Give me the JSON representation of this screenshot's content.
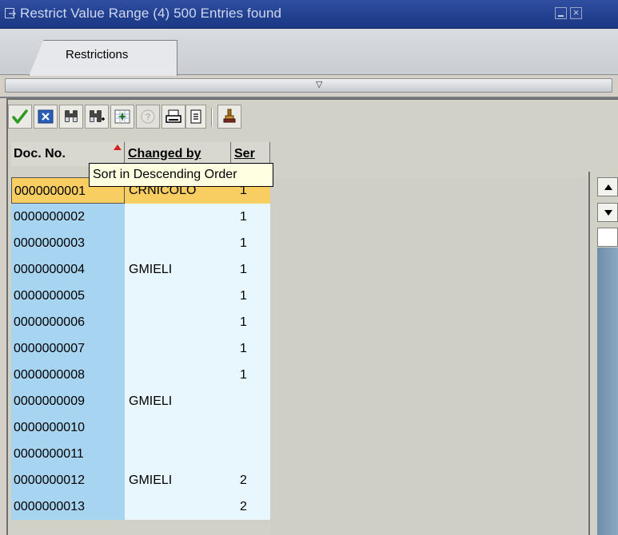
{
  "window": {
    "title": "Restrict Value Range (4)  500 Entries found",
    "minimize_icon": "minimize-icon",
    "close_icon": "close-icon"
  },
  "tabs": [
    {
      "label": "Restrictions",
      "active": true
    }
  ],
  "toolbar": {
    "buttons": [
      {
        "name": "confirm-button",
        "icon": "checkmark-icon"
      },
      {
        "name": "cancel-button",
        "icon": "x-icon"
      },
      {
        "name": "find-button",
        "icon": "binoculars-icon"
      },
      {
        "name": "find-next-button",
        "icon": "binoculars-plus-icon"
      },
      {
        "name": "new-search-button",
        "icon": "sparkle-grid-icon"
      },
      {
        "name": "help-button",
        "icon": "help-icon",
        "disabled": true
      },
      {
        "name": "print-button",
        "icon": "printer-icon"
      },
      {
        "name": "list-button",
        "icon": "list-icon"
      },
      {
        "name": "personal-list-button",
        "icon": "stamp-icon"
      }
    ]
  },
  "table": {
    "columns": [
      "Doc. No.",
      "Changed by",
      "Ser"
    ],
    "sorted_column": "Doc. No.",
    "rows": [
      {
        "doc": "0000000001",
        "changed_by": "CRNICOLO",
        "ser": "1",
        "selected": true
      },
      {
        "doc": "0000000002",
        "changed_by": "",
        "ser": "1"
      },
      {
        "doc": "0000000003",
        "changed_by": "",
        "ser": "1"
      },
      {
        "doc": "0000000004",
        "changed_by": "GMIELI",
        "ser": "1"
      },
      {
        "doc": "0000000005",
        "changed_by": "",
        "ser": "1"
      },
      {
        "doc": "0000000006",
        "changed_by": "",
        "ser": "1"
      },
      {
        "doc": "0000000007",
        "changed_by": "",
        "ser": "1"
      },
      {
        "doc": "0000000008",
        "changed_by": "",
        "ser": "1"
      },
      {
        "doc": "0000000009",
        "changed_by": "GMIELI",
        "ser": ""
      },
      {
        "doc": "0000000010",
        "changed_by": "",
        "ser": ""
      },
      {
        "doc": "0000000011",
        "changed_by": "",
        "ser": ""
      },
      {
        "doc": "0000000012",
        "changed_by": "GMIELI",
        "ser": "2"
      },
      {
        "doc": "0000000013",
        "changed_by": "",
        "ser": "2"
      }
    ]
  },
  "tooltip": {
    "text": "Sort in Descending Order"
  },
  "colors": {
    "title_bar": "#223f8f",
    "key_column": "#a7d4f0",
    "data_column": "#e8f6fd",
    "selected_row": "#f8cd62",
    "tooltip_bg": "#ffffe1"
  }
}
